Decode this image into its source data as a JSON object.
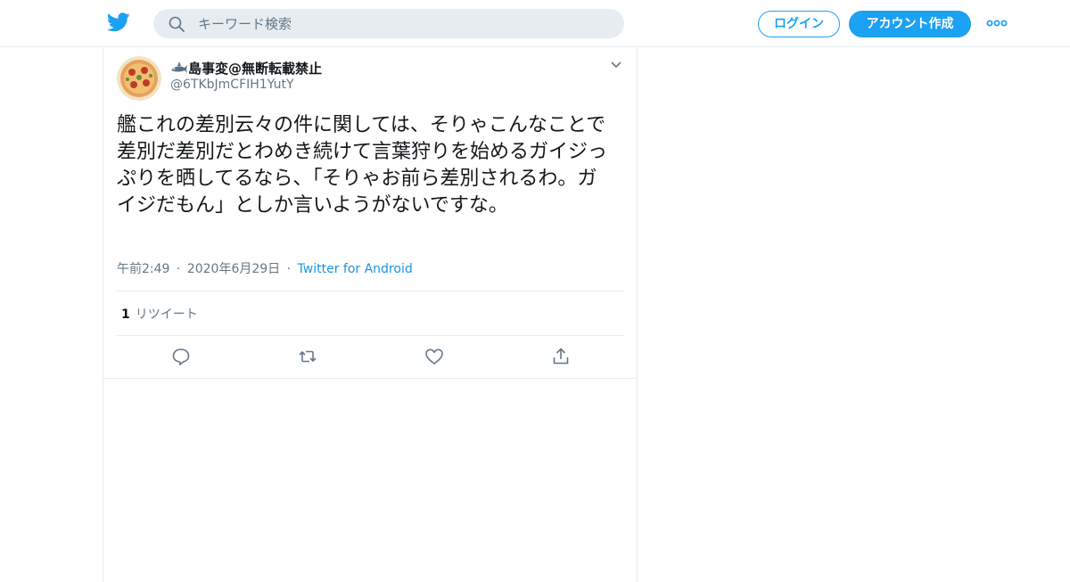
{
  "header": {
    "logo_icon": "twitter-bird-icon",
    "search": {
      "placeholder": "キーワード検索",
      "icon": "search-icon"
    },
    "login_label": "ログイン",
    "signup_label": "アカウント作成",
    "more_icon": "more-dots-icon"
  },
  "tweet": {
    "author": {
      "display_name": "島事変@無断転載禁止",
      "name_badge_icon": "shark-emoji-icon",
      "handle": "@6TKbJmCFIH1YutY",
      "avatar_icon": "pizza-avatar"
    },
    "text": "艦これの差別云々の件に関しては、そりゃこんなことで差別だ差別だとわめき続けて言葉狩りを始めるガイジっぷりを晒してるなら、「そりゃお前ら差別されるわ。ガイジだもん」としか言いようがないですな。",
    "time": "午前2:49",
    "date": "2020年6月29日",
    "separator": "·",
    "source": "Twitter for Android",
    "retweet_count": "1",
    "retweet_label": "リツイート",
    "actions": [
      "reply-icon",
      "retweet-icon",
      "like-icon",
      "share-icon"
    ]
  },
  "colors": {
    "brand_blue": "#1da1f2",
    "link_blue": "#1b95e0",
    "secondary_text": "#657786",
    "border": "#e6ecf0"
  }
}
